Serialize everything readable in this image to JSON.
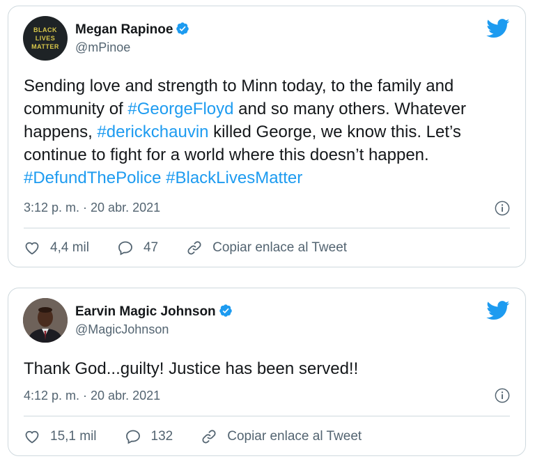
{
  "colors": {
    "accent": "#1d9bf0",
    "secondary_text": "#536471",
    "border": "#cfd9de"
  },
  "tweets": [
    {
      "author_name": "Megan Rapinoe",
      "handle": "@mPinoe",
      "avatar_text": [
        "BLACK",
        "LIVES",
        "MATTER"
      ],
      "text_parts": [
        "Sending love and strength to Minn today, to the family and community of ",
        "#GeorgeFloyd",
        " and so many others. Whatever happens, ",
        "#derickchauvin",
        " killed George, we know this. Let’s continue to fight for a world where this doesn’t happen. ",
        "#DefundThePolice",
        " ",
        "#BlackLivesMatter"
      ],
      "timestamp": "3:12 p. m. · 20 abr. 2021",
      "likes": "4,4 mil",
      "replies": "47",
      "copy_link_label": "Copiar enlace al Tweet"
    },
    {
      "author_name": "Earvin Magic Johnson",
      "handle": "@MagicJohnson",
      "text": "Thank God...guilty! Justice has been served!!",
      "timestamp": "4:12 p. m. · 20 abr. 2021",
      "likes": "15,1 mil",
      "replies": "132",
      "copy_link_label": "Copiar enlace al Tweet"
    }
  ]
}
